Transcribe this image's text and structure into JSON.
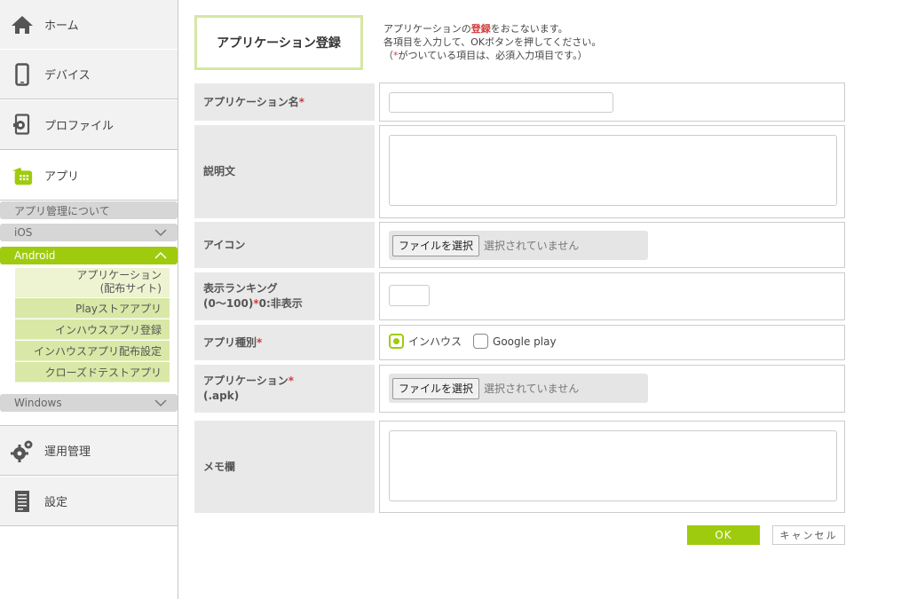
{
  "sidebar": {
    "home": "ホーム",
    "device": "デバイス",
    "profile": "プロファイル",
    "app": "アプリ",
    "app_about": "アプリ管理について",
    "ios": "iOS",
    "android": "Android",
    "android_items": {
      "app_distribution_line1": "アプリケーション",
      "app_distribution_line2": "(配布サイト)",
      "play_store": "Playストアアプリ",
      "inhouse_register": "インハウスアプリ登録",
      "inhouse_distribution": "インハウスアプリ配布設定",
      "closed_test": "クローズドテストアプリ"
    },
    "windows": "Windows",
    "operations": "運用管理",
    "settings": "設定"
  },
  "header": {
    "title": "アプリケーション登録",
    "desc_line1_pre": "アプリケーションの",
    "desc_line1_hl": "登録",
    "desc_line1_post": "をおこないます。",
    "desc_line2": "各項目を入力して、OKボタンを押してください。",
    "desc_line3_open": "（",
    "desc_line3_star": "*",
    "desc_line3_rest": "がついている項目は、必須入力項目です。）"
  },
  "form": {
    "app_name_label": "アプリケーション名",
    "app_name_value": "",
    "description_label": "説明文",
    "description_value": "",
    "icon_label": "アイコン",
    "file_button": "ファイルを選択",
    "no_file": "選択されていません",
    "ranking_label_line1": "表示ランキング",
    "ranking_label_line2_pre": "(0〜100)",
    "ranking_label_line2_post": "0:非表示",
    "ranking_value": "",
    "app_type_label": "アプリ種別",
    "app_type_options": [
      "インハウス",
      "Google play"
    ],
    "app_type_selected": "インハウス",
    "apk_label_line1": "アプリケーション",
    "apk_label_line2": "(.apk)",
    "memo_label": "メモ欄",
    "memo_value": "",
    "required_mark": "*"
  },
  "buttons": {
    "ok": "OK",
    "cancel": "キャンセル"
  },
  "colors": {
    "accent": "#9fcb0e",
    "required": "#d03c3c"
  }
}
